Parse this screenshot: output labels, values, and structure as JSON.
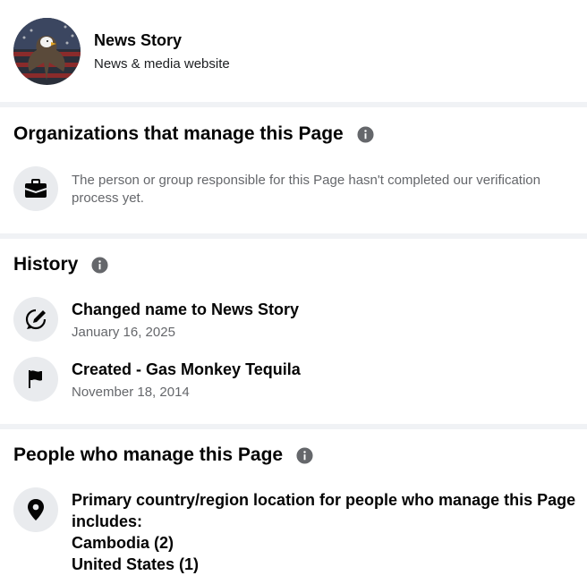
{
  "profile": {
    "name": "News Story",
    "category": "News & media website"
  },
  "organizations": {
    "title": "Organizations that manage this Page",
    "message": "The person or group responsible for this Page hasn't completed our verification process yet."
  },
  "history": {
    "title": "History",
    "items": [
      {
        "icon": "name-change-icon",
        "text": "Changed name to News Story",
        "date": "January 16, 2025"
      },
      {
        "icon": "flag-icon",
        "text": "Created - Gas Monkey Tequila",
        "date": "November 18, 2014"
      }
    ]
  },
  "people": {
    "title": "People who manage this Page",
    "location_line1": "Primary country/region location for people who manage this Page",
    "location_line2": "includes:",
    "countries": [
      "Cambodia (2)",
      "United States (1)"
    ]
  },
  "colors": {
    "divider": "#f0f2f5",
    "icon_background": "#e9ebee",
    "muted_text": "#65676b"
  }
}
